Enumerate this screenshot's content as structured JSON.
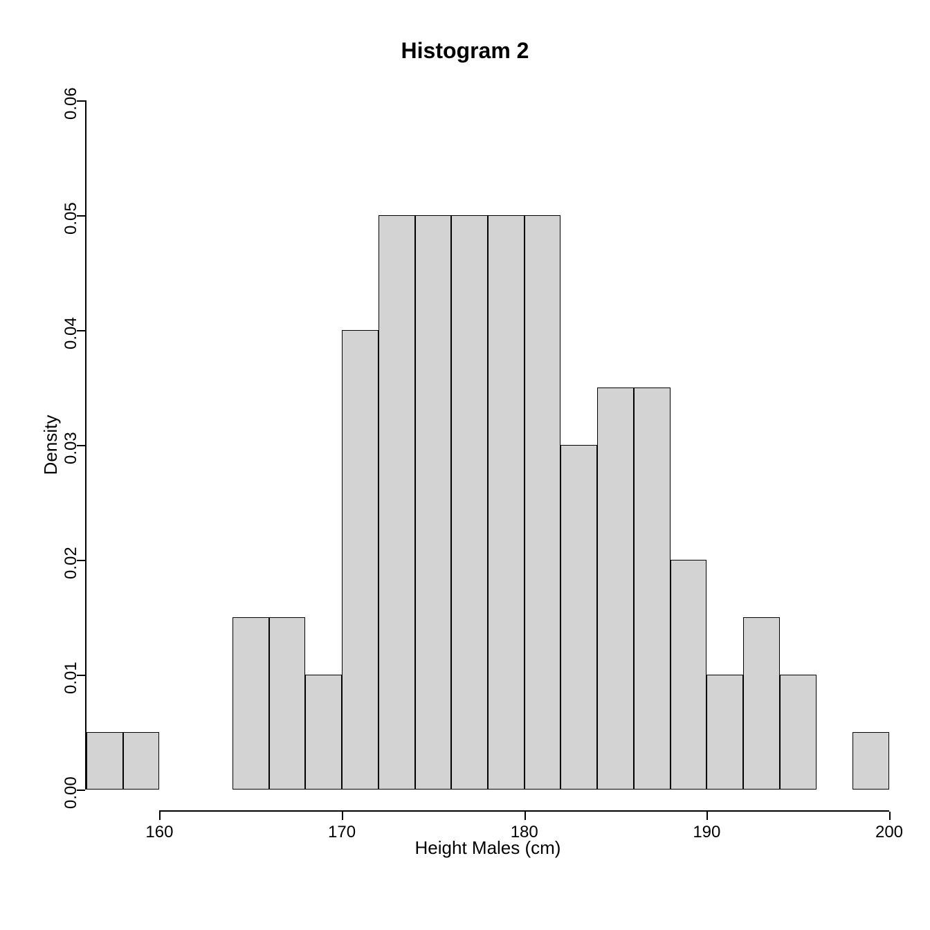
{
  "chart_data": {
    "type": "bar",
    "title": "Histogram 2",
    "xlabel": "Height Males (cm)",
    "ylabel": "Density",
    "xlim": [
      156,
      200
    ],
    "ylim": [
      0,
      0.06
    ],
    "x_ticks": [
      160,
      170,
      180,
      190,
      200
    ],
    "y_ticks": [
      0.0,
      0.01,
      0.02,
      0.03,
      0.04,
      0.05,
      0.06
    ],
    "y_tick_labels": [
      "0.00",
      "0.01",
      "0.02",
      "0.03",
      "0.04",
      "0.05",
      "0.06"
    ],
    "bin_width": 2,
    "bins": [
      {
        "start": 156,
        "end": 158,
        "density": 0.005
      },
      {
        "start": 158,
        "end": 160,
        "density": 0.005
      },
      {
        "start": 160,
        "end": 162,
        "density": 0.0
      },
      {
        "start": 162,
        "end": 164,
        "density": 0.0
      },
      {
        "start": 164,
        "end": 166,
        "density": 0.015
      },
      {
        "start": 166,
        "end": 168,
        "density": 0.015
      },
      {
        "start": 168,
        "end": 170,
        "density": 0.01
      },
      {
        "start": 170,
        "end": 172,
        "density": 0.04
      },
      {
        "start": 172,
        "end": 174,
        "density": 0.05
      },
      {
        "start": 174,
        "end": 176,
        "density": 0.05
      },
      {
        "start": 176,
        "end": 178,
        "density": 0.05
      },
      {
        "start": 178,
        "end": 180,
        "density": 0.05
      },
      {
        "start": 180,
        "end": 182,
        "density": 0.05
      },
      {
        "start": 182,
        "end": 184,
        "density": 0.03
      },
      {
        "start": 184,
        "end": 186,
        "density": 0.035
      },
      {
        "start": 186,
        "end": 188,
        "density": 0.035
      },
      {
        "start": 188,
        "end": 190,
        "density": 0.02
      },
      {
        "start": 190,
        "end": 192,
        "density": 0.01
      },
      {
        "start": 192,
        "end": 194,
        "density": 0.015
      },
      {
        "start": 194,
        "end": 196,
        "density": 0.01
      },
      {
        "start": 196,
        "end": 198,
        "density": 0.0
      },
      {
        "start": 198,
        "end": 200,
        "density": 0.005
      }
    ]
  }
}
